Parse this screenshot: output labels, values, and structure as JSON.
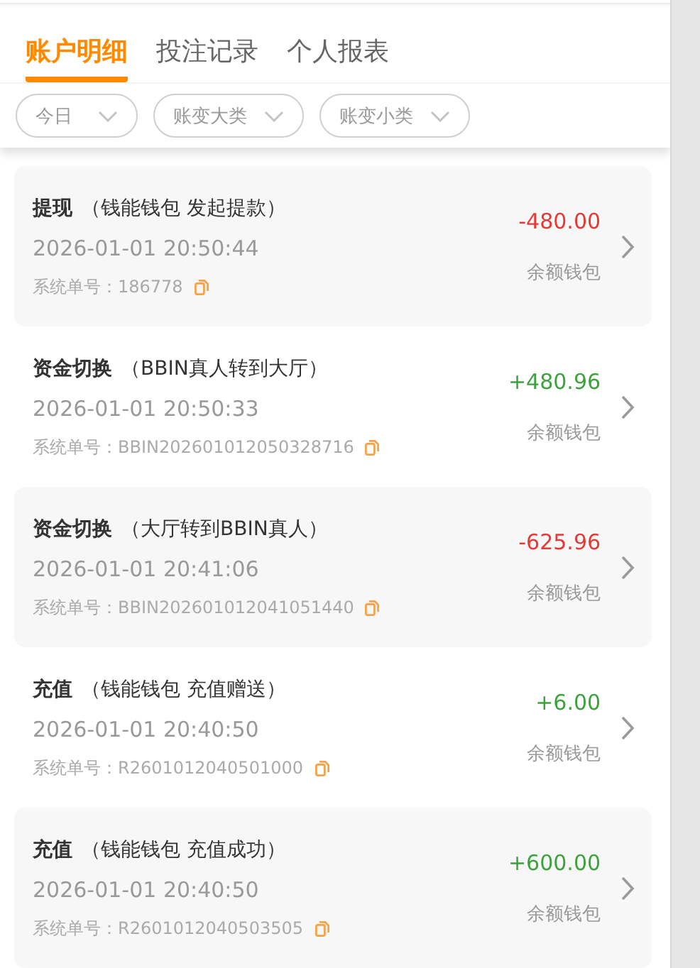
{
  "tabs": [
    {
      "label": "账户明细",
      "selected": true
    },
    {
      "label": "投注记录",
      "selected": false
    },
    {
      "label": "个人报表",
      "selected": false
    }
  ],
  "filters": [
    {
      "label": "今日"
    },
    {
      "label": "账变大类"
    },
    {
      "label": "账变小类"
    }
  ],
  "records": [
    {
      "type": "提现",
      "detail": "（钱能钱包 发起提款）",
      "time": "2026-01-01 20:50:44",
      "order_label": "系统单号：",
      "order_no": "186778",
      "amount": "-480.00",
      "color": "#e53935",
      "wallet": "余额钱包"
    },
    {
      "type": "资金切换",
      "detail": "（BBIN真人转到大厅）",
      "time": "2026-01-01 20:50:33",
      "order_label": "系统单号：",
      "order_no": "BBIN202601012050328716",
      "amount": "+480.96",
      "color": "#3ca33c",
      "wallet": "余额钱包"
    },
    {
      "type": "资金切换",
      "detail": "（大厅转到BBIN真人）",
      "time": "2026-01-01 20:41:06",
      "order_label": "系统单号：",
      "order_no": "BBIN202601012041051440",
      "amount": "-625.96",
      "color": "#e53935",
      "wallet": "余额钱包"
    },
    {
      "type": "充值",
      "detail": "（钱能钱包 充值赠送）",
      "time": "2026-01-01 20:40:50",
      "order_label": "系统单号：",
      "order_no": "R2601012040501000",
      "amount": "+6.00",
      "color": "#3ca33c",
      "wallet": "余额钱包"
    },
    {
      "type": "充值",
      "detail": "（钱能钱包 充值成功）",
      "time": "2026-01-01 20:40:50",
      "order_label": "系统单号：",
      "order_no": "R2601012040503505",
      "amount": "+600.00",
      "color": "#3ca33c",
      "wallet": "余额钱包"
    }
  ]
}
